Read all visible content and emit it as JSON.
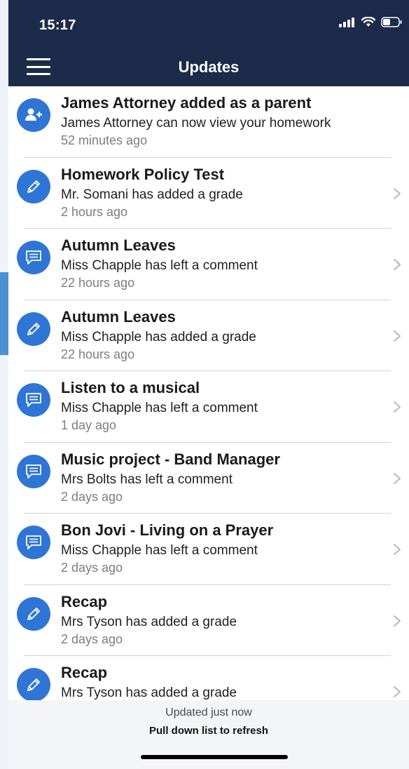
{
  "status_bar": {
    "time": "15:17"
  },
  "nav": {
    "title": "Updates"
  },
  "colors": {
    "header_bg": "#1d2b4a",
    "accent": "#2f75d5",
    "subtle_text": "#7d7d80"
  },
  "updates": [
    {
      "icon": "add-user-icon",
      "title": "James Attorney added as a parent",
      "subtitle": "James Attorney can now view your homework",
      "time": "52 minutes ago",
      "has_chevron": false
    },
    {
      "icon": "pencil-icon",
      "title": "Homework Policy Test",
      "subtitle": "Mr. Somani has added a grade",
      "time": "2 hours ago",
      "has_chevron": true
    },
    {
      "icon": "comment-icon",
      "title": "Autumn Leaves",
      "subtitle": "Miss Chapple has left a comment",
      "time": "22 hours ago",
      "has_chevron": true
    },
    {
      "icon": "pencil-icon",
      "title": "Autumn Leaves",
      "subtitle": "Miss Chapple has added a grade",
      "time": "22 hours ago",
      "has_chevron": true
    },
    {
      "icon": "comment-icon",
      "title": "Listen to a musical",
      "subtitle": "Miss Chapple has left a comment",
      "time": "1 day ago",
      "has_chevron": true
    },
    {
      "icon": "comment-icon",
      "title": "Music project - Band Manager",
      "subtitle": "Mrs Bolts has left a comment",
      "time": "2 days ago",
      "has_chevron": true
    },
    {
      "icon": "comment-icon",
      "title": "Bon Jovi - Living on a Prayer",
      "subtitle": "Miss Chapple has left a comment",
      "time": "2 days ago",
      "has_chevron": true
    },
    {
      "icon": "pencil-icon",
      "title": "Recap",
      "subtitle": "Mrs Tyson has added a grade",
      "time": "2 days ago",
      "has_chevron": true
    },
    {
      "icon": "pencil-icon",
      "title": "Recap",
      "subtitle": "Mrs Tyson has added a grade",
      "time": "",
      "has_chevron": true
    }
  ],
  "footer": {
    "updated": "Updated just now",
    "hint": "Pull down list to refresh"
  }
}
